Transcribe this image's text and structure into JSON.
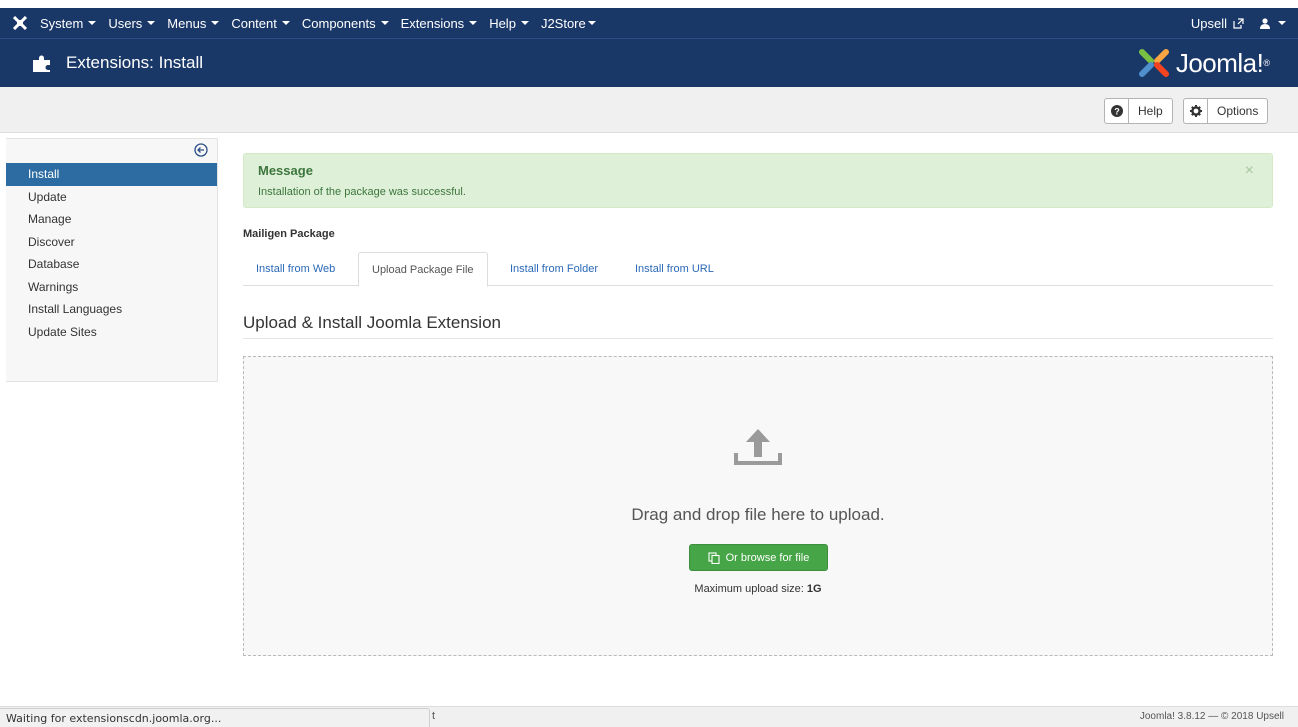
{
  "topnav": {
    "menus": [
      "System",
      "Users",
      "Menus",
      "Content",
      "Components",
      "Extensions",
      "Help",
      "J2Store"
    ],
    "site_link": "Upsell"
  },
  "header": {
    "title": "Extensions: Install",
    "brand": "Joomla!"
  },
  "toolbar": {
    "help_label": "Help",
    "options_label": "Options"
  },
  "sidebar": {
    "items": [
      "Install",
      "Update",
      "Manage",
      "Discover",
      "Database",
      "Warnings",
      "Install Languages",
      "Update Sites"
    ],
    "active": "Install"
  },
  "alert": {
    "heading": "Message",
    "text": "Installation of the package was successful.",
    "close": "×"
  },
  "package_title": "Mailigen Package",
  "tabs": [
    "Install from Web",
    "Upload Package File",
    "Install from Folder",
    "Install from URL"
  ],
  "active_tab": "Upload Package File",
  "section_title": "Upload & Install Joomla Extension",
  "dropzone": {
    "text": "Drag and drop file here to upload.",
    "button": "Or browse for file",
    "max_label": "Maximum upload size:",
    "max_value": "1G"
  },
  "footer": {
    "version": "Joomla! 3.8.12 — © 2018 Upsell"
  },
  "status_bar": {
    "text": "Waiting for extensionscdn.joomla.org...",
    "stray": "t"
  },
  "colors": {
    "nav_bg": "#1a3867",
    "active_blue": "#2d6ca2",
    "success_bg": "#dff0d8",
    "button_green": "#46a546"
  }
}
